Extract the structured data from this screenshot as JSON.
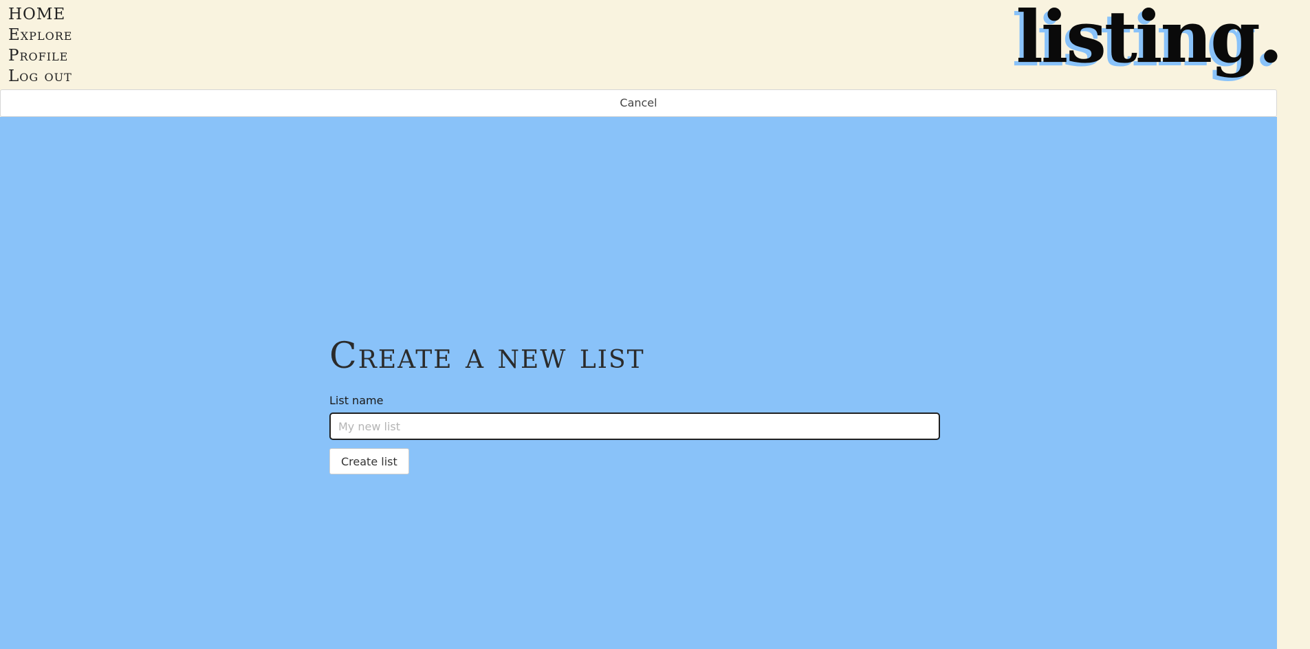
{
  "nav": {
    "items": [
      {
        "label": "HOME"
      },
      {
        "label": "Explore"
      },
      {
        "label": "Profile"
      },
      {
        "label": "Log out"
      }
    ]
  },
  "logo": {
    "text": "listing."
  },
  "cancel": {
    "label": "Cancel"
  },
  "form": {
    "title": "Create a new list",
    "list_name_label": "List name",
    "list_name_placeholder": "My new list",
    "list_name_value": "",
    "submit_label": "Create list"
  },
  "colors": {
    "page_background": "#f9f3df",
    "panel_background": "#89c2f9",
    "logo_shadow": "#89c2f9"
  }
}
